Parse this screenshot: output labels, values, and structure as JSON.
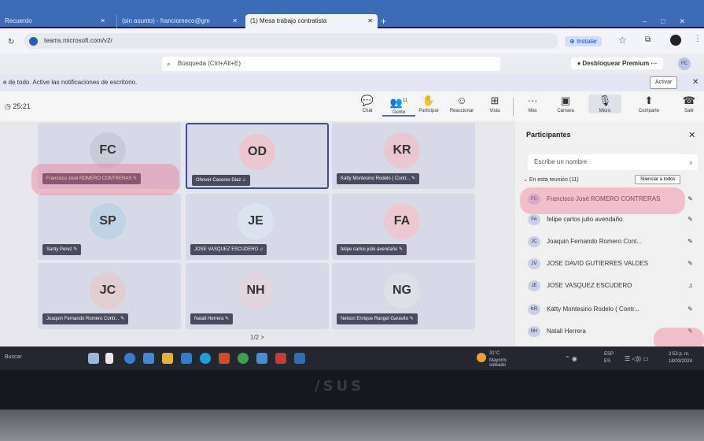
{
  "browser": {
    "tabs": [
      {
        "label": "Recuerdo"
      },
      {
        "label": "(sin asunto) - franciomeco@gm"
      },
      {
        "label": "(1) Mesa trabajo contratista"
      }
    ],
    "new_tab": "+",
    "url": "teams.microsoft.com/v2/",
    "install_label": "Instalar"
  },
  "teams": {
    "search_placeholder": "Búsqueda (Ctrl+Alt+E)",
    "premium_label": "Desbloquear Premium",
    "user_initials": "FC",
    "notification": "e de todo. Active las notificaciones de escritorio.",
    "notification_button": "Activar"
  },
  "meeting": {
    "timer": "25:21",
    "toolbar": {
      "chat": "Chat",
      "people": "Gente",
      "people_count": "11",
      "raise": "Participar",
      "react": "Reaccionar",
      "view": "Vista",
      "more": "Más",
      "camera": "Cámara",
      "mic": "Micro",
      "share": "Comparte",
      "leave": "Salir"
    },
    "tiles": [
      {
        "initials": "FC",
        "name": "Francisco José ROMERO CONTRERAS",
        "color": "#c9ccd8"
      },
      {
        "initials": "OD",
        "name": "Ohover Caceres Diaz",
        "color": "#ecc6cf"
      },
      {
        "initials": "KR",
        "name": "Katty Montesino Rodelo ( Contr...",
        "color": "#e9c7d2"
      },
      {
        "initials": "SP",
        "name": "Santy Perez",
        "color": "#bfd3e6"
      },
      {
        "initials": "JE",
        "name": "JOSE VASQUEZ ESCUDERO",
        "color": "#d9e4ee"
      },
      {
        "initials": "FA",
        "name": "felipe carlos julio avendaño",
        "color": "#ecc8d2"
      },
      {
        "initials": "JC",
        "name": "Joaquin Fernando Romero Contr...",
        "color": "#e2cdd3"
      },
      {
        "initials": "NH",
        "name": "Natali Herrera",
        "color": "#e3d5dd"
      },
      {
        "initials": "NG",
        "name": "Nelson Enrique Rangel Garavito",
        "color": "#dde0e6"
      }
    ],
    "pager": "1/2  >"
  },
  "participants": {
    "title": "Participantes",
    "search_placeholder": "Escribe un nombre",
    "section": "En esta reunión (11)",
    "mute_all": "Silenciar a todos",
    "list": [
      {
        "initials": "FC",
        "name": "Francisco José ROMERO CONTRERAS"
      },
      {
        "initials": "FA",
        "name": "felipe carlos julio avendaño"
      },
      {
        "initials": "JC",
        "name": "Joaquin Fernando Romero Cont..."
      },
      {
        "initials": "JV",
        "name": "JOSE DAVID GUTIERRES VALDES"
      },
      {
        "initials": "JE",
        "name": "JOSE VASQUEZ ESCUDERO"
      },
      {
        "initials": "KR",
        "name": "Katty Montesino Rodelo ( Contr..."
      },
      {
        "initials": "NH",
        "name": "Natali Herrera"
      }
    ]
  },
  "taskbar": {
    "search": "Buscar",
    "weather_temp": "31°C",
    "weather_desc": "Mayorm. soleado",
    "lang1": "ESP",
    "lang2": "ES",
    "time": "2:53 p. m.",
    "date": "18/03/2024"
  },
  "laptop": {
    "brand": "/SUS"
  }
}
